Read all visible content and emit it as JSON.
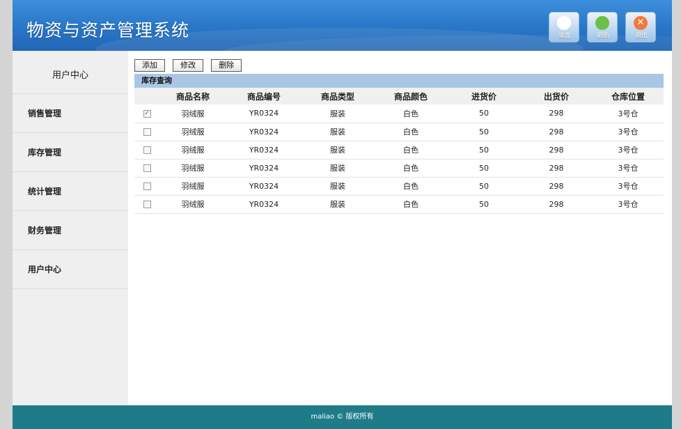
{
  "header": {
    "title": "物资与资产管理系统",
    "buttons": [
      {
        "label": "桌面",
        "icon": "home-icon"
      },
      {
        "label": "刷新",
        "icon": "refresh-icon"
      },
      {
        "label": "退出",
        "icon": "exit-icon"
      }
    ]
  },
  "sidebar": {
    "top_label": "用户中心",
    "items": [
      {
        "label": "销售管理"
      },
      {
        "label": "库存管理"
      },
      {
        "label": "统计管理"
      },
      {
        "label": "财务管理"
      },
      {
        "label": "用户中心"
      }
    ]
  },
  "toolbar": {
    "add_label": "添加",
    "edit_label": "修改",
    "delete_label": "删除"
  },
  "panel": {
    "title": "库存查询"
  },
  "table": {
    "headers": [
      "",
      "商品名称",
      "商品编号",
      "商品类型",
      "商品颜色",
      "进货价",
      "出货价",
      "仓库位置"
    ],
    "rows": [
      {
        "checked": true,
        "cells": [
          "羽绒服",
          "YR0324",
          "服装",
          "白色",
          "50",
          "298",
          "3号仓"
        ]
      },
      {
        "checked": false,
        "cells": [
          "羽绒服",
          "YR0324",
          "服装",
          "白色",
          "50",
          "298",
          "3号仓"
        ]
      },
      {
        "checked": false,
        "cells": [
          "羽绒服",
          "YR0324",
          "服装",
          "白色",
          "50",
          "298",
          "3号仓"
        ]
      },
      {
        "checked": false,
        "cells": [
          "羽绒服",
          "YR0324",
          "服装",
          "白色",
          "50",
          "298",
          "3号仓"
        ]
      },
      {
        "checked": false,
        "cells": [
          "羽绒服",
          "YR0324",
          "服装",
          "白色",
          "50",
          "298",
          "3号仓"
        ]
      },
      {
        "checked": false,
        "cells": [
          "羽绒服",
          "YR0324",
          "服装",
          "白色",
          "50",
          "298",
          "3号仓"
        ]
      }
    ]
  },
  "footer": {
    "text": "maliao © 版权所有"
  },
  "colors": {
    "header": "#2a78c8",
    "footer": "#1e7c88",
    "panel_title": "#a9c7e4",
    "sidebar": "#efefef"
  }
}
